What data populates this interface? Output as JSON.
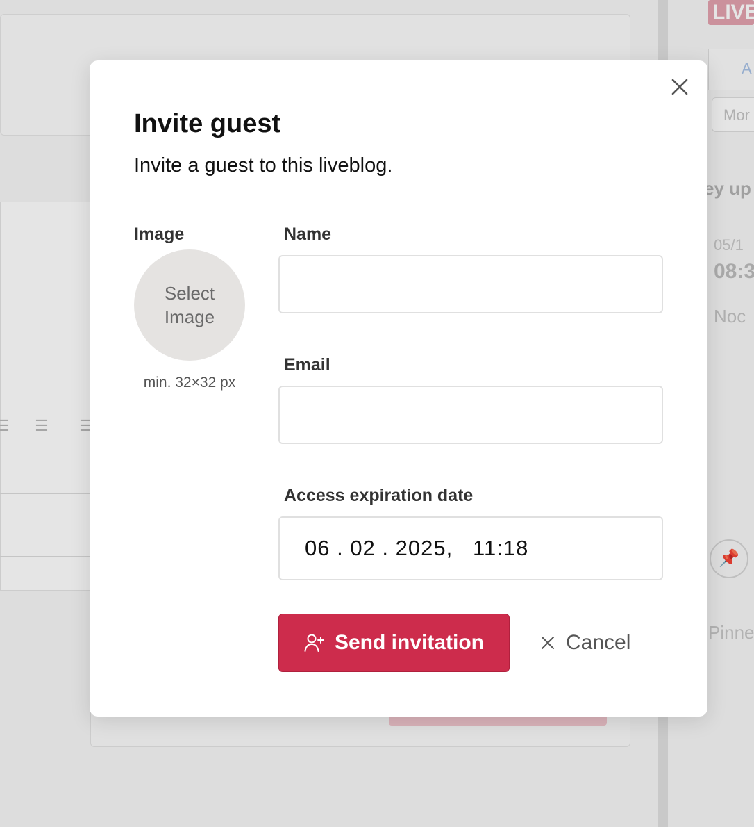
{
  "background": {
    "live_badge": "LIVE",
    "tab_label": "A",
    "select_value": "Mor",
    "heading": "ey up",
    "entry_date": "05/1",
    "entry_time": "08:3",
    "entry_author": "Noc",
    "pinned_label": "Pinne"
  },
  "modal": {
    "title": "Invite guest",
    "subtitle": "Invite a guest to this liveblog.",
    "close_icon": "close-icon",
    "image": {
      "label": "Image",
      "picker_text": "Select Image",
      "hint": "min. 32×32 px"
    },
    "name": {
      "label": "Name",
      "value": "",
      "placeholder": ""
    },
    "email": {
      "label": "Email",
      "value": "",
      "placeholder": ""
    },
    "expiration": {
      "label": "Access expiration date",
      "value": "06 . 02 . 2025,   11:18"
    },
    "send_button": {
      "label": "Send invitation",
      "icon": "add-user-icon"
    },
    "cancel_button": {
      "label": "Cancel",
      "icon": "close-icon"
    }
  },
  "colors": {
    "primary": "#cd2c4c",
    "overlay": "rgba(0,0,0,0.10)"
  }
}
